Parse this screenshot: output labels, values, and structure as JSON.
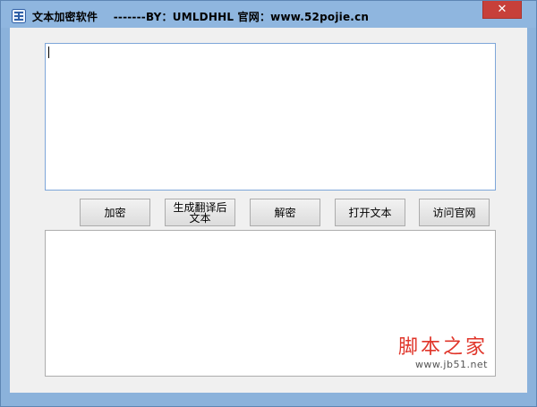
{
  "window": {
    "title": "文本加密软件    -------BY：UMLDHHL 官网：www.52pojie.cn",
    "close_label": "✕"
  },
  "editor": {
    "input_value": "",
    "output_value": ""
  },
  "buttons": {
    "encrypt": "加密",
    "generate": "生成翻译后文本",
    "decrypt": "解密",
    "open": "打开文本",
    "visit": "访问官网"
  },
  "watermark": {
    "title": "脚本之家",
    "url": "www.jb51.net"
  },
  "colors": {
    "frame": "#8bb2db",
    "close": "#c7403a",
    "watermark": "#e0352a"
  }
}
